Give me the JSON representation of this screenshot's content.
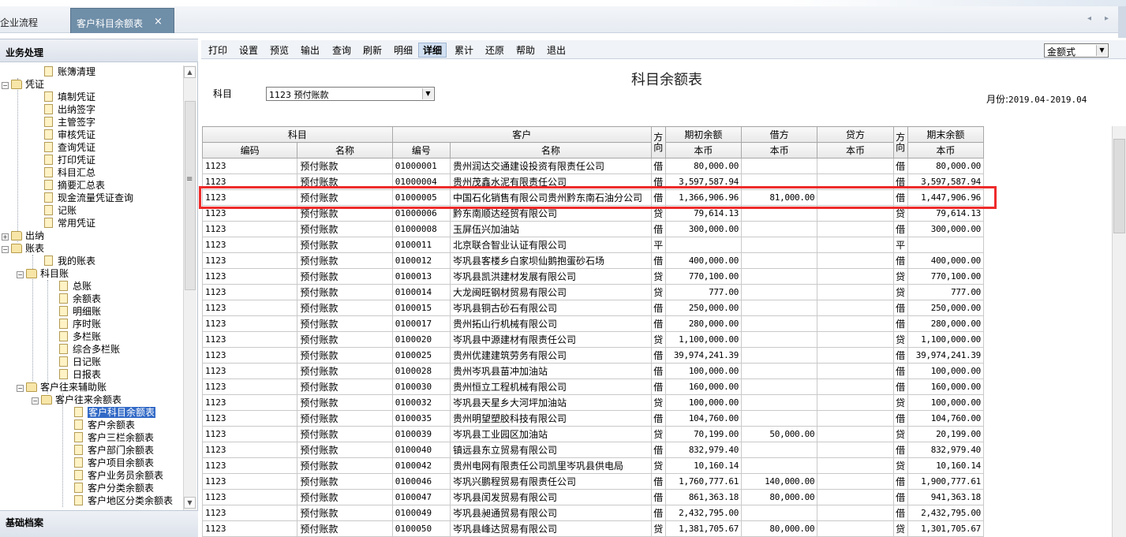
{
  "tabs": {
    "flow_label": "企业流程",
    "active_label": "客户科目余额表",
    "close_glyph": "×",
    "nav_prev": "◂",
    "nav_next": "▸"
  },
  "left": {
    "header": "业务处理",
    "footer": "基础档案",
    "tree": [
      {
        "label": "账簿清理",
        "level": 3,
        "kind": "doc"
      },
      {
        "label": "凭证",
        "level": 1,
        "kind": "folder",
        "exp": "−"
      },
      {
        "label": "填制凭证",
        "level": 3,
        "kind": "doc"
      },
      {
        "label": "出纳签字",
        "level": 3,
        "kind": "doc"
      },
      {
        "label": "主管签字",
        "level": 3,
        "kind": "doc"
      },
      {
        "label": "审核凭证",
        "level": 3,
        "kind": "doc"
      },
      {
        "label": "查询凭证",
        "level": 3,
        "kind": "doc"
      },
      {
        "label": "打印凭证",
        "level": 3,
        "kind": "doc"
      },
      {
        "label": "科目汇总",
        "level": 3,
        "kind": "doc"
      },
      {
        "label": "摘要汇总表",
        "level": 3,
        "kind": "doc"
      },
      {
        "label": "现金流量凭证查询",
        "level": 3,
        "kind": "doc"
      },
      {
        "label": "记账",
        "level": 3,
        "kind": "doc"
      },
      {
        "label": "常用凭证",
        "level": 3,
        "kind": "doc"
      },
      {
        "label": "出纳",
        "level": 1,
        "kind": "folder",
        "exp": "+"
      },
      {
        "label": "账表",
        "level": 1,
        "kind": "folder",
        "exp": "−"
      },
      {
        "label": "我的账表",
        "level": 3,
        "kind": "doc"
      },
      {
        "label": "科目账",
        "level": 2,
        "kind": "folder",
        "exp": "−"
      },
      {
        "label": "总账",
        "level": 4,
        "kind": "doc"
      },
      {
        "label": "余额表",
        "level": 4,
        "kind": "doc"
      },
      {
        "label": "明细账",
        "level": 4,
        "kind": "doc"
      },
      {
        "label": "序时账",
        "level": 4,
        "kind": "doc"
      },
      {
        "label": "多栏账",
        "level": 4,
        "kind": "doc"
      },
      {
        "label": "综合多栏账",
        "level": 4,
        "kind": "doc"
      },
      {
        "label": "日记账",
        "level": 4,
        "kind": "doc"
      },
      {
        "label": "日报表",
        "level": 4,
        "kind": "doc"
      },
      {
        "label": "客户往来辅助账",
        "level": 2,
        "kind": "folder",
        "exp": "−"
      },
      {
        "label": "客户往来余额表",
        "level": 3,
        "kind": "folder",
        "exp": "−"
      },
      {
        "label": "客户科目余额表",
        "level": 5,
        "kind": "doc",
        "selected": true
      },
      {
        "label": "客户余额表",
        "level": 5,
        "kind": "doc"
      },
      {
        "label": "客户三栏余额表",
        "level": 5,
        "kind": "doc"
      },
      {
        "label": "客户部门余额表",
        "level": 5,
        "kind": "doc"
      },
      {
        "label": "客户项目余额表",
        "level": 5,
        "kind": "doc"
      },
      {
        "label": "客户业务员余额表",
        "level": 5,
        "kind": "doc"
      },
      {
        "label": "客户分类余额表",
        "level": 5,
        "kind": "doc"
      },
      {
        "label": "客户地区分类余额表",
        "level": 5,
        "kind": "doc"
      }
    ]
  },
  "toolbar": {
    "buttons": [
      "打印",
      "设置",
      "预览",
      "输出",
      "查询",
      "刷新",
      "明细",
      "详细",
      "累计",
      "还原",
      "帮助",
      "退出"
    ],
    "active": "详细",
    "mode": "金额式"
  },
  "report": {
    "title": "科目余额表",
    "subject_label": "科目",
    "subject_value": "1123 预付账款",
    "month_label": "月份:",
    "month_value": "2019.04-2019.04"
  },
  "table": {
    "group_headers": [
      "科目",
      "客户",
      "方向",
      "期初余额",
      "借方",
      "贷方",
      "方向",
      "期末余额"
    ],
    "sub_headers": [
      "编码",
      "名称",
      "编号",
      "名称",
      "本币",
      "本币",
      "本币",
      "本币"
    ],
    "rows": [
      [
        "1123",
        "预付账款",
        "01000001",
        "贵州润达交通建设投资有限责任公司",
        "借",
        "80,000.00",
        "",
        "",
        "借",
        "80,000.00"
      ],
      [
        "1123",
        "预付账款",
        "01000004",
        "贵州茂鑫水泥有限责任公司",
        "借",
        "3,597,587.94",
        "",
        "",
        "借",
        "3,597,587.94"
      ],
      [
        "1123",
        "预付账款",
        "01000005",
        "中国石化销售有限公司贵州黔东南石油分公司",
        "借",
        "1,366,906.96",
        "81,000.00",
        "",
        "借",
        "1,447,906.96"
      ],
      [
        "1123",
        "预付账款",
        "01000006",
        "黔东南顺达经贸有限公司",
        "贷",
        "79,614.13",
        "",
        "",
        "贷",
        "79,614.13"
      ],
      [
        "1123",
        "预付账款",
        "01000008",
        "玉屏伍兴加油站",
        "借",
        "300,000.00",
        "",
        "",
        "借",
        "300,000.00"
      ],
      [
        "1123",
        "预付账款",
        "0100011",
        "北京联合智业认证有限公司",
        "平",
        "",
        "",
        "",
        "平",
        ""
      ],
      [
        "1123",
        "预付账款",
        "0100012",
        "岑巩县客楼乡白家坝仙鹅抱蛋砂石场",
        "借",
        "400,000.00",
        "",
        "",
        "借",
        "400,000.00"
      ],
      [
        "1123",
        "预付账款",
        "0100013",
        "岑巩县凯洪建材发展有限公司",
        "贷",
        "770,100.00",
        "",
        "",
        "贷",
        "770,100.00"
      ],
      [
        "1123",
        "预付账款",
        "0100014",
        "大龙闽旺钢材贸易有限公司",
        "贷",
        "777.00",
        "",
        "",
        "贷",
        "777.00"
      ],
      [
        "1123",
        "预付账款",
        "0100015",
        "岑巩县铜古砂石有限公司",
        "借",
        "250,000.00",
        "",
        "",
        "借",
        "250,000.00"
      ],
      [
        "1123",
        "预付账款",
        "0100017",
        "贵州拓山行机械有限公司",
        "借",
        "280,000.00",
        "",
        "",
        "借",
        "280,000.00"
      ],
      [
        "1123",
        "预付账款",
        "0100020",
        "岑巩县中源建材有限责任公司",
        "贷",
        "1,100,000.00",
        "",
        "",
        "贷",
        "1,100,000.00"
      ],
      [
        "1123",
        "预付账款",
        "0100025",
        "贵州优建建筑劳务有限公司",
        "借",
        "39,974,241.39",
        "",
        "",
        "借",
        "39,974,241.39"
      ],
      [
        "1123",
        "预付账款",
        "0100028",
        "贵州岑巩县苗冲加油站",
        "借",
        "100,000.00",
        "",
        "",
        "借",
        "100,000.00"
      ],
      [
        "1123",
        "预付账款",
        "0100030",
        "贵州恒立工程机械有限公司",
        "借",
        "160,000.00",
        "",
        "",
        "借",
        "160,000.00"
      ],
      [
        "1123",
        "预付账款",
        "0100032",
        "岑巩县天星乡大河坪加油站",
        "贷",
        "100,000.00",
        "",
        "",
        "贷",
        "100,000.00"
      ],
      [
        "1123",
        "预付账款",
        "0100035",
        "贵州明望塑胶科技有限公司",
        "借",
        "104,760.00",
        "",
        "",
        "借",
        "104,760.00"
      ],
      [
        "1123",
        "预付账款",
        "0100039",
        "岑巩县工业园区加油站",
        "贷",
        "70,199.00",
        "50,000.00",
        "",
        "贷",
        "20,199.00"
      ],
      [
        "1123",
        "预付账款",
        "0100040",
        "镇远县东立贸易有限公司",
        "借",
        "832,979.40",
        "",
        "",
        "借",
        "832,979.40"
      ],
      [
        "1123",
        "预付账款",
        "0100042",
        "贵州电网有限责任公司凯里岑巩县供电局",
        "贷",
        "10,160.14",
        "",
        "",
        "贷",
        "10,160.14"
      ],
      [
        "1123",
        "预付账款",
        "0100046",
        "岑巩兴鹏程贸易有限责任公司",
        "借",
        "1,760,777.61",
        "140,000.00",
        "",
        "借",
        "1,900,777.61"
      ],
      [
        "1123",
        "预付账款",
        "0100047",
        "岑巩县闰发贸易有限公司",
        "借",
        "861,363.18",
        "80,000.00",
        "",
        "借",
        "941,363.18"
      ],
      [
        "1123",
        "预付账款",
        "0100049",
        "岑巩县昶通贸易有限公司",
        "借",
        "2,432,795.00",
        "",
        "",
        "借",
        "2,432,795.00"
      ],
      [
        "1123",
        "预付账款",
        "0100050",
        "岑巩县峰达贸易有限公司",
        "贷",
        "1,381,705.67",
        "80,000.00",
        "",
        "贷",
        "1,301,705.67"
      ]
    ]
  }
}
